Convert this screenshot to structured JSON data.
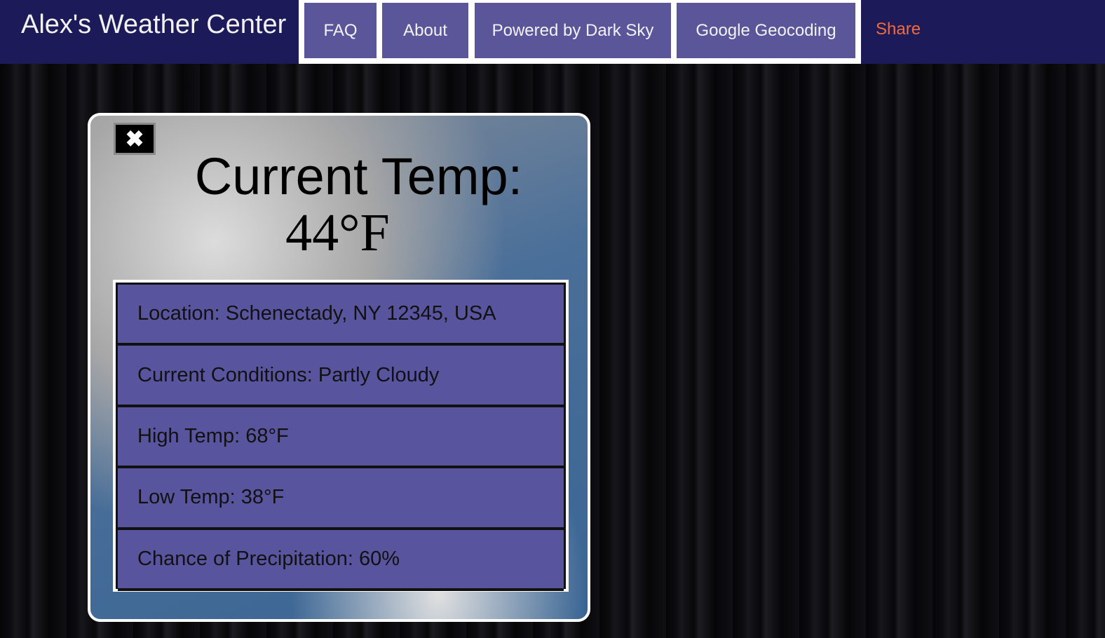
{
  "nav": {
    "brand": "Alex's Weather Center",
    "buttons": [
      "FAQ",
      "About",
      "Powered by Dark Sky",
      "Google Geocoding"
    ],
    "share": "Share"
  },
  "card": {
    "close_icon": "close-icon",
    "title": "Current Temp:",
    "temp": "44°F",
    "rows": [
      "Location: Schenectady, NY 12345, USA",
      "Current Conditions: Partly Cloudy",
      "High Temp: 68°F",
      "Low Temp: 38°F",
      "Chance of Precipitation: 60%"
    ]
  },
  "colors": {
    "nav": "#1d1a5a",
    "button": "#5a5699",
    "share": "#f26b3a"
  }
}
